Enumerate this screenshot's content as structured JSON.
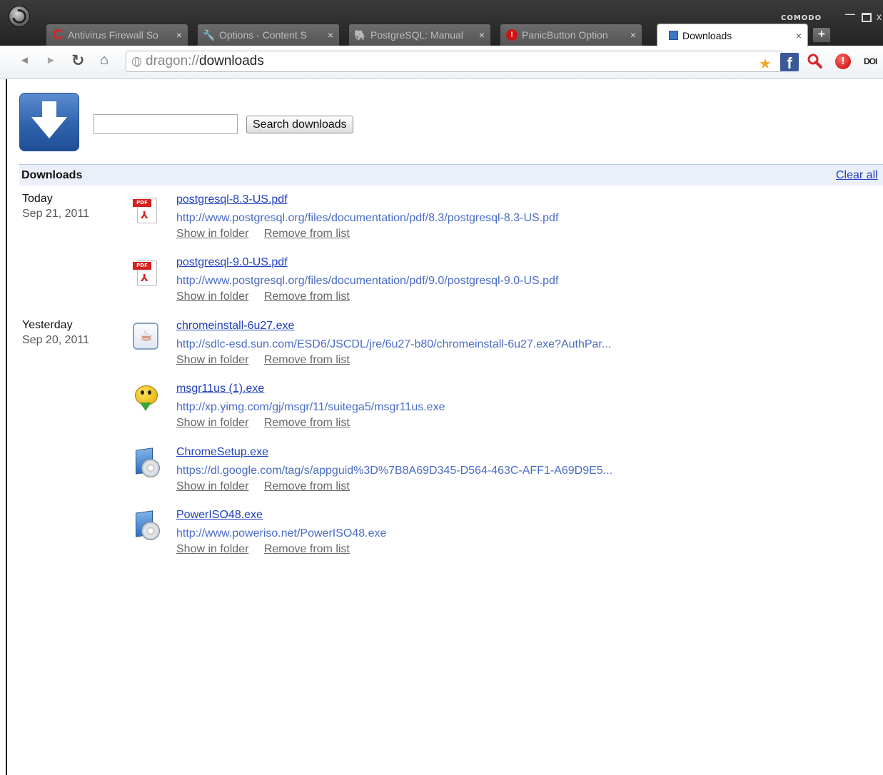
{
  "window": {
    "brand": "COMODO",
    "controls": {
      "minimize": "—",
      "close": "x"
    }
  },
  "tabs": [
    {
      "title": "Antivirus Firewall So",
      "icon": "comodo-c-icon",
      "active": false
    },
    {
      "title": "Options - Content S",
      "icon": "wrench-icon",
      "active": false
    },
    {
      "title": "PostgreSQL: Manual",
      "icon": "postgresql-elephant-icon",
      "active": false
    },
    {
      "title": "PanicButton Option",
      "icon": "panic-button-icon",
      "active": false
    },
    {
      "title": "Downloads",
      "icon": "downloads-page-icon",
      "active": true
    }
  ],
  "tab_close_glyph": "×",
  "new_tab_glyph": "+",
  "toolbar": {
    "back": "◄",
    "forward": "►",
    "reload": "↻",
    "home": "⌂",
    "url_scheme": "dragon://",
    "url_path": "downloads",
    "star": "★",
    "facebook": "f",
    "magnify": "🔍",
    "panic": "!",
    "extension": "DOI"
  },
  "search": {
    "value": "",
    "placeholder": "",
    "button_label": "Search downloads"
  },
  "section": {
    "title": "Downloads",
    "clear_all": "Clear all"
  },
  "groups": [
    {
      "label": "Today",
      "date": "Sep 21, 2011"
    },
    {
      "label": "Yesterday",
      "date": "Sep 20, 2011"
    }
  ],
  "downloads": [
    {
      "name": "postgresql-8.3-US.pdf",
      "url": "http://www.postgresql.org/files/documentation/pdf/8.3/postgresql-8.3-US.pdf",
      "icon": "pdf-file-icon"
    },
    {
      "name": "postgresql-9.0-US.pdf",
      "url": "http://www.postgresql.org/files/documentation/pdf/9.0/postgresql-9.0-US.pdf",
      "icon": "pdf-file-icon"
    },
    {
      "name": "chromeinstall-6u27.exe",
      "url": "http://sdlc-esd.sun.com/ESD6/JSCDL/jre/6u27-b80/chromeinstall-6u27.exe?AuthPar...",
      "icon": "java-installer-icon"
    },
    {
      "name": "msgr11us (1).exe",
      "url": "http://xp.yimg.com/gj/msgr/11/suitega5/msgr11us.exe",
      "icon": "yahoo-messenger-icon"
    },
    {
      "name": "ChromeSetup.exe",
      "url": "https://dl.google.com/tag/s/appguid%3D%7B8A69D345-D564-463C-AFF1-A69D9E5...",
      "icon": "setup-installer-icon"
    },
    {
      "name": "PowerISO48.exe",
      "url": "http://www.poweriso.net/PowerISO48.exe",
      "icon": "setup-installer-icon"
    }
  ],
  "actions": {
    "show_in_folder": "Show in folder",
    "remove_from_list": "Remove from list"
  },
  "colors": {
    "link": "#1f3fbf",
    "url": "#4a6cc7",
    "section_bar": "#ebeff9",
    "logo_blue": "#2f63ad"
  }
}
